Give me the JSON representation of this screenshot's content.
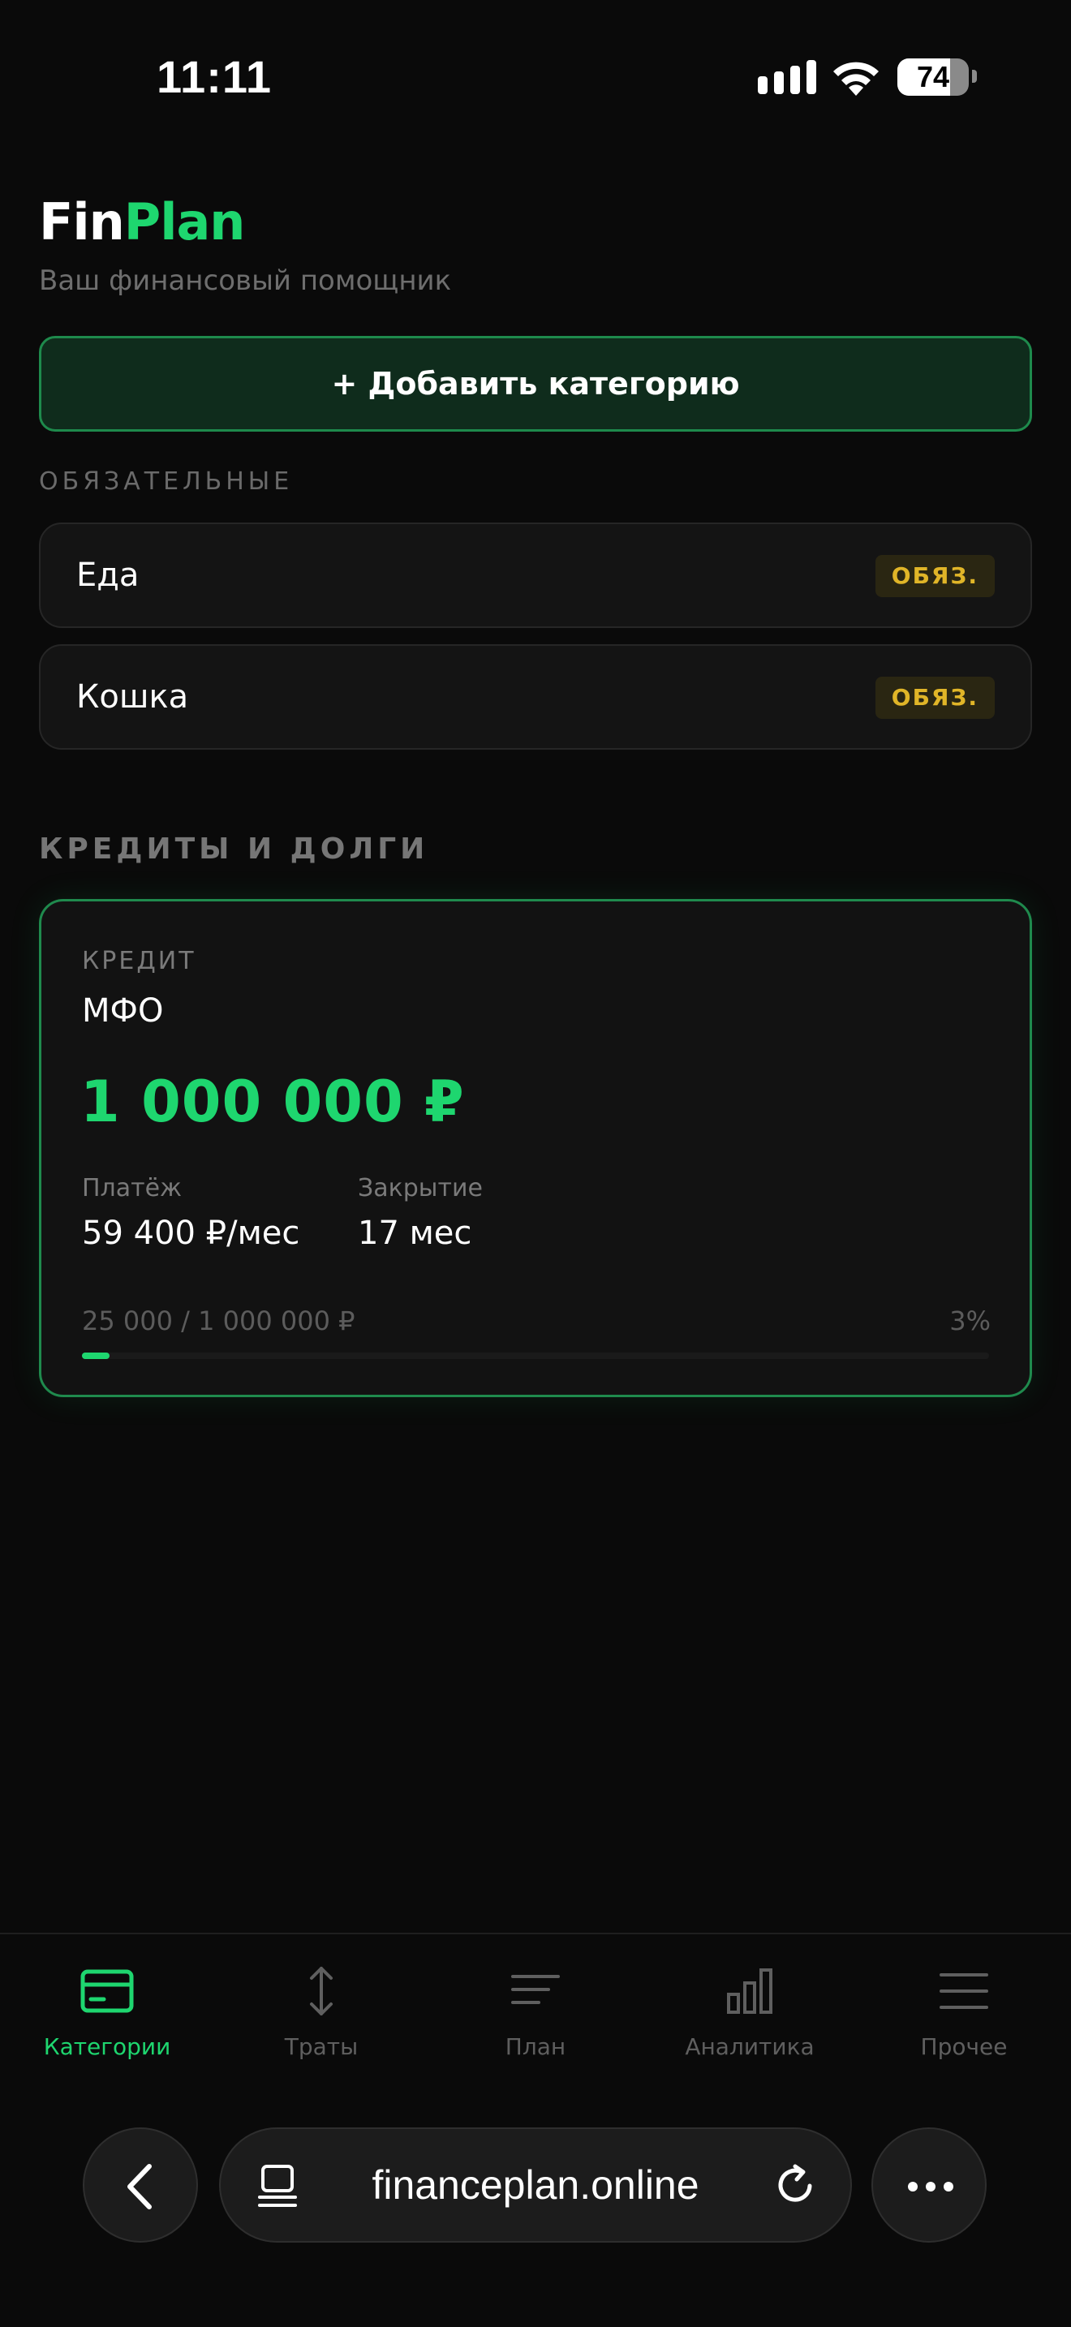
{
  "status_bar": {
    "time": "11:11",
    "battery_percent": "74",
    "battery_level": 0.74
  },
  "header": {
    "logo_part1": "Fin",
    "logo_part2": "Plan",
    "tagline": "Ваш финансовый помощник"
  },
  "add_category_label": "+ Добавить категорию",
  "mandatory": {
    "section_label": "ОБЯЗАТЕЛЬНЫЕ",
    "items": [
      {
        "name": "Еда",
        "badge": "ОБЯЗ."
      },
      {
        "name": "Кошка",
        "badge": "ОБЯЗ."
      }
    ]
  },
  "credits": {
    "section_label": "КРЕДИТЫ И ДОЛГИ",
    "cards": [
      {
        "type": "КРЕДИТ",
        "name": "МФО",
        "amount": "1 000 000 ₽",
        "payment_label": "Платёж",
        "payment_value": "59 400 ₽/мес",
        "closing_label": "Закрытие",
        "closing_value": "17 мес",
        "progress_text": "25 000 / 1 000 000 ₽",
        "progress_percent_text": "3%",
        "progress_percent": 3
      }
    ]
  },
  "bottom_nav": {
    "items": [
      {
        "label": "Категории",
        "icon": "card-icon",
        "active": true
      },
      {
        "label": "Траты",
        "icon": "arrows-vertical-icon",
        "active": false
      },
      {
        "label": "План",
        "icon": "lines-icon",
        "active": false
      },
      {
        "label": "Аналитика",
        "icon": "bar-chart-icon",
        "active": false
      },
      {
        "label": "Прочее",
        "icon": "menu-icon",
        "active": false
      }
    ]
  },
  "browser": {
    "url": "financeplan.online"
  },
  "colors": {
    "accent": "#1ed66f",
    "badge_text": "#e0b528",
    "background": "#0a0a0a"
  }
}
